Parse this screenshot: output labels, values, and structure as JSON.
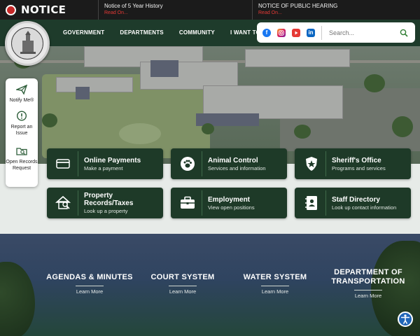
{
  "notice_bar": {
    "label": "NOTICE",
    "items": [
      {
        "title": "Notice of 5 Year History",
        "link": "Read On..."
      },
      {
        "title": "NOTICE OF PUBLIC HEARING",
        "link": "Read On..."
      }
    ]
  },
  "nav": {
    "items": [
      "GOVERNMENT",
      "DEPARTMENTS",
      "COMMUNITY",
      "I WANT TO..."
    ]
  },
  "social": {
    "icons": [
      "facebook-icon",
      "instagram-icon",
      "youtube-icon",
      "linkedin-icon"
    ]
  },
  "search": {
    "placeholder": "Search..."
  },
  "sidebar": {
    "items": [
      {
        "label": "Notify Me®",
        "icon": "paper-plane-icon"
      },
      {
        "label": "Report an Issue",
        "icon": "exclamation-bubble-icon"
      },
      {
        "label": "Open Records Request",
        "icon": "folder-search-icon"
      }
    ]
  },
  "quick_links": [
    {
      "title": "Online Payments",
      "subtitle": "Make a payment",
      "icon": "credit-card-icon"
    },
    {
      "title": "Animal Control",
      "subtitle": "Services and information",
      "icon": "paw-icon"
    },
    {
      "title": "Sheriff's Office",
      "subtitle": "Programs and services",
      "icon": "badge-shield-icon"
    },
    {
      "title": "Property Records/Taxes",
      "subtitle": "Look up a property",
      "icon": "house-search-icon"
    },
    {
      "title": "Employment",
      "subtitle": "View open positions",
      "icon": "briefcase-icon"
    },
    {
      "title": "Staff Directory",
      "subtitle": "Look up contact information",
      "icon": "address-book-icon"
    }
  ],
  "bottom_links": [
    {
      "title": "AGENDAS & MINUTES",
      "more": "Learn More"
    },
    {
      "title": "COURT SYSTEM",
      "more": "Learn More"
    },
    {
      "title": "WATER SYSTEM",
      "more": "Learn More"
    },
    {
      "title": "DEPARTMENT OF TRANSPORTATION",
      "more": "Learn More"
    }
  ],
  "colors": {
    "brand_green": "#1e3a28",
    "notice_red": "#e53935",
    "notice_bg": "#1b1b1b"
  }
}
